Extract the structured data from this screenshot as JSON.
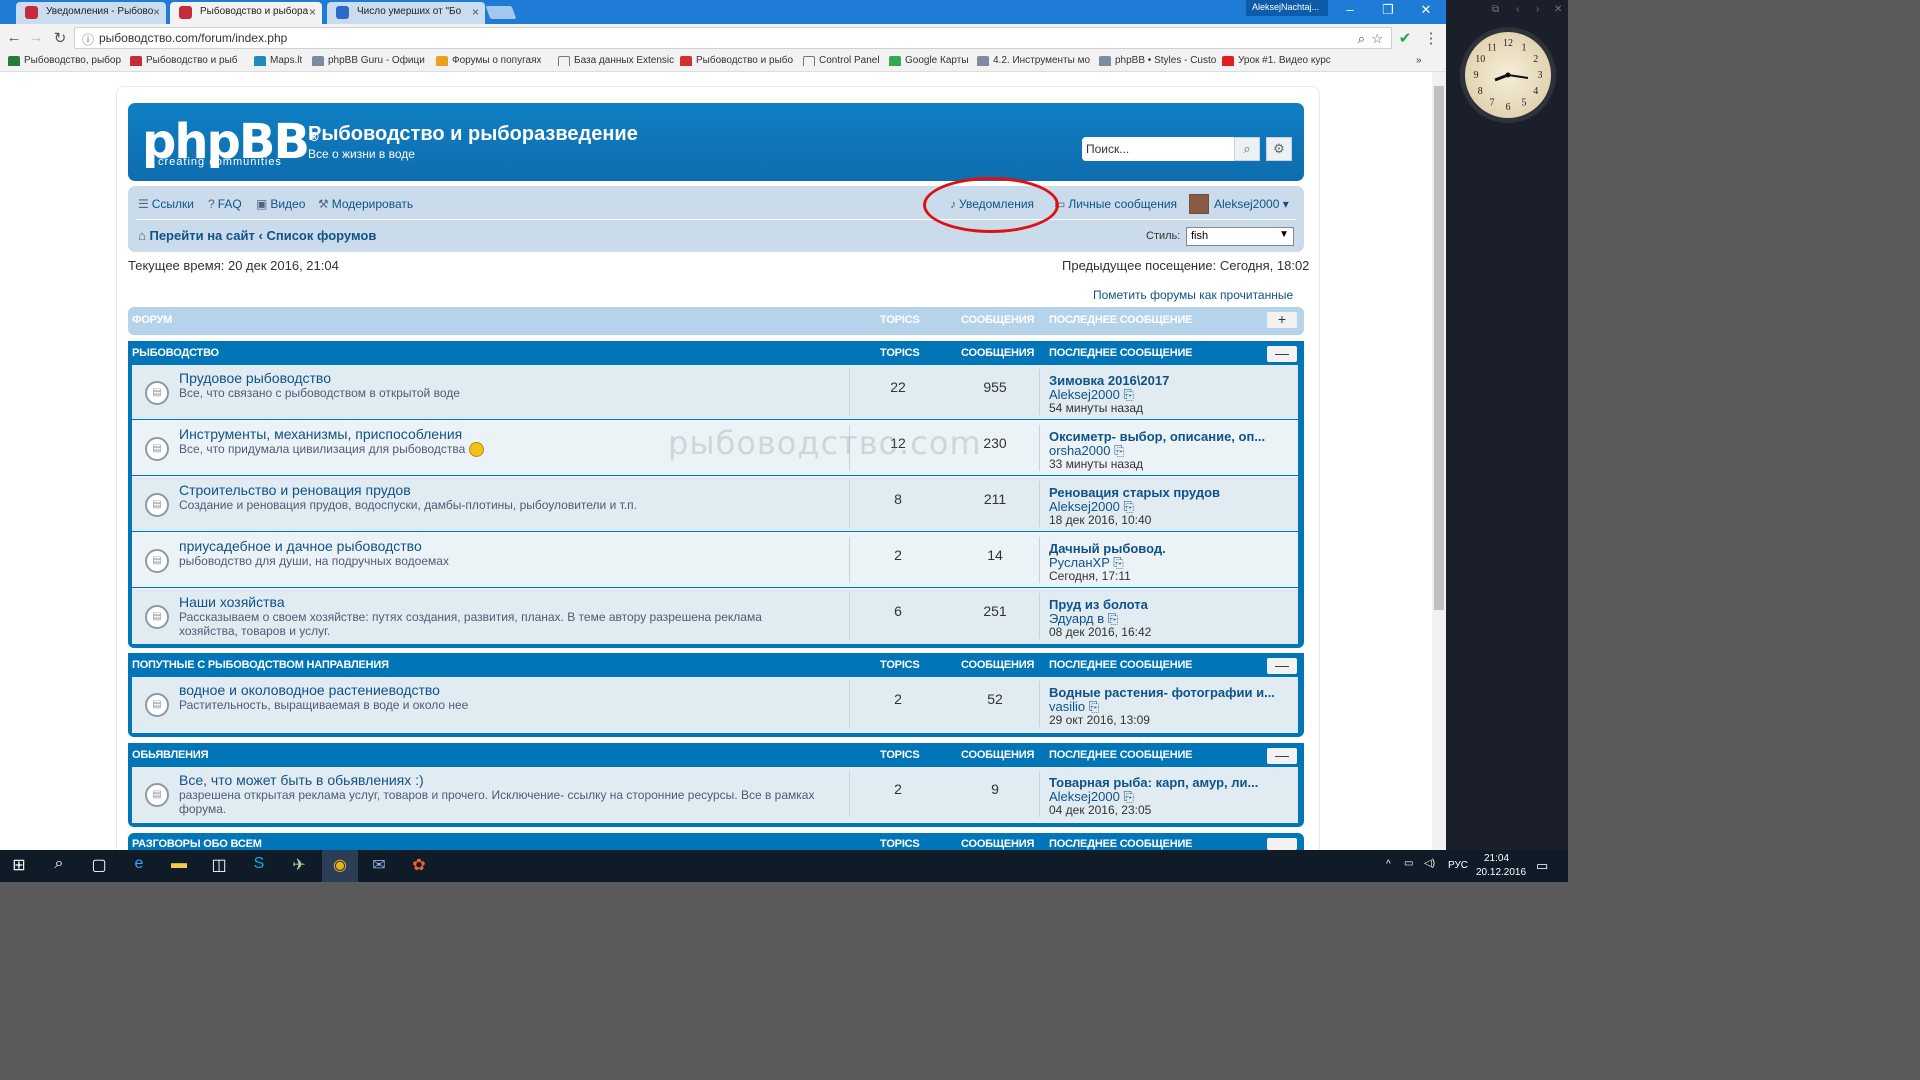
{
  "browser": {
    "tabs": [
      {
        "title": "Уведомления - Рыбово"
      },
      {
        "title": "Рыбоводство и рыбора"
      },
      {
        "title": "Число умерших от \"Бо"
      }
    ],
    "user": "AleksejNachtaj...",
    "url": "рыбоводство.com/forum/index.php",
    "bookmarks": [
      "Рыбоводство, рыбор",
      "Рыбоводство и рыб",
      "Maps.lt",
      "phpBB Guru - Офици",
      "Форумы о попугаях",
      "База данных Extensic",
      "Рыбоводство и рыбо",
      "Control Panel",
      "Google Карты",
      "4.2. Инструменты мо",
      "phpBB • Styles - Custo",
      "Урок #1. Видео курс"
    ],
    "more": "»"
  },
  "forum": {
    "logo": "phpBB",
    "logo_reg": "®",
    "logo_sub": "creating   communities",
    "site_title": "Рыбоводство и рыборазведение",
    "site_desc": "Все о жизни в воде",
    "search_placeholder": "Поиск...",
    "nav": {
      "links": "Ссылки",
      "faq": "FAQ",
      "video": "Видео",
      "moderate": "Модерировать",
      "notifications": "Уведомления",
      "pm": "Личные сообщения",
      "user": "Aleksej2000 ▾"
    },
    "breadcrumb_site": "Перейти на сайт",
    "breadcrumb_sep": "‹",
    "breadcrumb_forums": "Список форумов",
    "style_label": "Стиль:",
    "style_value": "fish",
    "current_time": "Текущее время: 20 дек 2016, 21:04",
    "last_visit": "Предыдущее посещение: Сегодня, 18:02",
    "mark_read": "Пометить форумы как прочитанные",
    "columns": {
      "forum": "Форум",
      "topics": "Topics",
      "posts": "Сообщения",
      "last": "Последнее сообщение"
    },
    "watermark": "рыбоводство.com",
    "categories": [
      {
        "name": "Рыбоводство",
        "forums": [
          {
            "title": "Прудовое рыбоводство",
            "desc": "Все, что связано с рыбоводством в открытой воде",
            "topics": "22",
            "posts": "955",
            "last_title": "Зимовка 2016\\2017",
            "last_user": "Aleksej2000",
            "last_time": "54 минуты назад"
          },
          {
            "title": "Инструменты, механизмы, приспособления",
            "desc": "Все, что придумала цивилизация для рыбоводства",
            "topics": "12",
            "posts": "230",
            "last_title": "Оксиметр- выбор, описание, оп...",
            "last_user": "orsha2000",
            "last_time": "33 минуты назад"
          },
          {
            "title": "Строительство и реновация прудов",
            "desc": "Создание и реновация прудов, водоспуски, дамбы-плотины, рыбоуловители и т.п.",
            "topics": "8",
            "posts": "211",
            "last_title": "Реновация старых прудов",
            "last_user": "Aleksej2000",
            "last_time": "18 дек 2016, 10:40"
          },
          {
            "title": "приусадебное и дачное рыбоводство",
            "desc": "рыбоводство для души, на подручных водоемах",
            "topics": "2",
            "posts": "14",
            "last_title": "Дачный рыбовод.",
            "last_user": "РусланXP",
            "last_time": "Сегодня, 17:11"
          },
          {
            "title": "Наши хозяйства",
            "desc": "Рассказываем о своем хозяйстве: путях создания, развития, планах. В теме автору разрешена реклама хозяйства, товаров и услуг.",
            "topics": "6",
            "posts": "251",
            "last_title": "Пруд из болота",
            "last_user": "Эдуард в",
            "last_time": "08 дек 2016, 16:42"
          }
        ]
      },
      {
        "name": "Попутные с рыбоводством направления",
        "forums": [
          {
            "title": "водное и околоводное растениеводство",
            "desc": "Растительность, выращиваемая в воде и около нее",
            "topics": "2",
            "posts": "52",
            "last_title": "Водные растения- фотографии и...",
            "last_user": "vasilio",
            "last_time": "29 окт 2016, 13:09"
          }
        ]
      },
      {
        "name": "Обьявления",
        "forums": [
          {
            "title": "Все, что может быть в обьявлениях :)",
            "desc": "разрешена открытая реклама услуг, товаров и прочего. Исключение- ссылку на сторонние ресурсы. Все в рамках форума.",
            "topics": "2",
            "posts": "9",
            "last_title": "Товарная рыба: карп, амур, ли...",
            "last_user": "Aleksej2000",
            "last_time": "04 дек 2016, 23:05"
          }
        ]
      },
      {
        "name": "Разговоры обо всем",
        "forums": []
      }
    ]
  },
  "taskbar": {
    "lang": "РУС",
    "time": "21:04",
    "date": "20.12.2016"
  },
  "desktop": {
    "clock_numbers": [
      "12",
      "1",
      "2",
      "3",
      "4",
      "5",
      "6",
      "7",
      "8",
      "9",
      "10",
      "11"
    ]
  }
}
